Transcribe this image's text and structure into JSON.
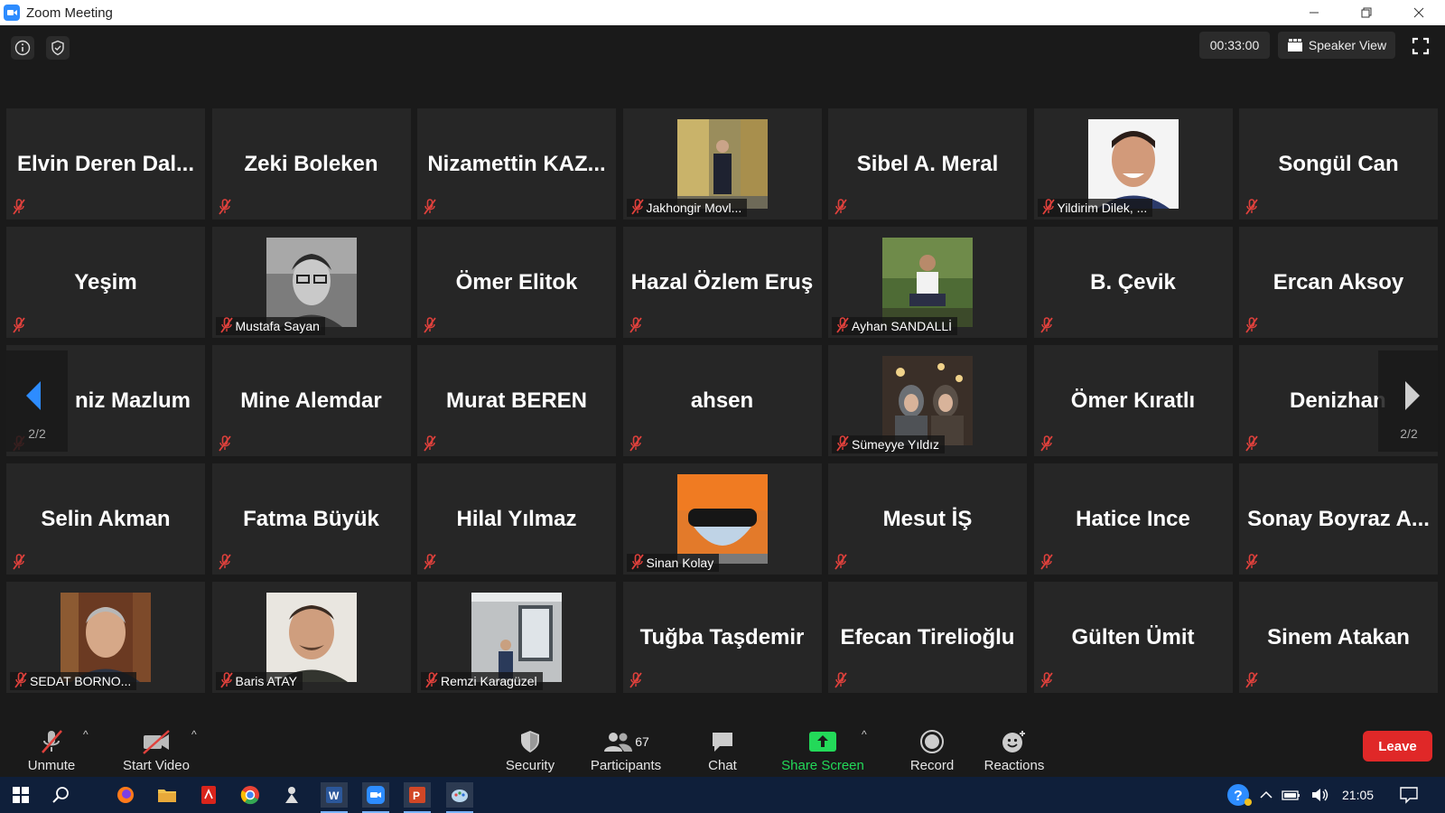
{
  "window": {
    "title": "Zoom Meeting"
  },
  "topbar": {
    "timer": "00:33:00",
    "view_button": "Speaker View"
  },
  "pagination": {
    "left_page": "2/2",
    "right_page": "2/2"
  },
  "tiles": [
    {
      "name": "Elvin  Deren  Dal...",
      "video": false
    },
    {
      "name": "Zeki Boleken",
      "video": false
    },
    {
      "name": "Nizamettin  KAZ...",
      "video": false
    },
    {
      "name": "Jakhongir Movl...",
      "video": true,
      "photo": "photo-1"
    },
    {
      "name": "Sibel A. Meral",
      "video": false
    },
    {
      "name": "Yildirim Dilek, ...",
      "video": true,
      "photo": "photo-2"
    },
    {
      "name": "Songül Can",
      "video": false
    },
    {
      "name": "Yeşim",
      "video": false
    },
    {
      "name": "Mustafa Sayan",
      "video": true,
      "photo": "photo-3"
    },
    {
      "name": "Ömer Elitok",
      "video": false
    },
    {
      "name": "Hazal Özlem Eruş",
      "video": false
    },
    {
      "name": "Ayhan SANDALLİ",
      "video": true,
      "photo": "photo-4"
    },
    {
      "name": "B. Çevik",
      "video": false
    },
    {
      "name": "Ercan Aksoy",
      "video": false
    },
    {
      "name": "niz Mazlum",
      "video": false
    },
    {
      "name": "Mine Alemdar",
      "video": false
    },
    {
      "name": "Murat BEREN",
      "video": false
    },
    {
      "name": "ahsen",
      "video": false
    },
    {
      "name": "Sümeyye Yıldız",
      "video": true,
      "photo": "photo-5"
    },
    {
      "name": "Ömer Kıratlı",
      "video": false
    },
    {
      "name": "Denizhan",
      "video": false
    },
    {
      "name": "Selin Akman",
      "video": false
    },
    {
      "name": "Fatma Büyük",
      "video": false
    },
    {
      "name": "Hilal Yılmaz",
      "video": false
    },
    {
      "name": "Sinan Kolay",
      "video": true,
      "photo": "photo-6"
    },
    {
      "name": "Mesut İŞ",
      "video": false
    },
    {
      "name": "Hatice Ince",
      "video": false
    },
    {
      "name": "Sonay  Boyraz  A...",
      "video": false
    },
    {
      "name": "SEDAT BORNO...",
      "video": true,
      "photo": "photo-7"
    },
    {
      "name": "Baris ATAY",
      "video": true,
      "photo": "photo-8"
    },
    {
      "name": "Remzi Karagüzel",
      "video": true,
      "photo": "photo-9"
    },
    {
      "name": "Tuğba Taşdemir",
      "video": false
    },
    {
      "name": "Efecan Tirelioğlu",
      "video": false
    },
    {
      "name": "Gülten Ümit",
      "video": false
    },
    {
      "name": "Sinem Atakan",
      "video": false
    }
  ],
  "toolbar": {
    "unmute": "Unmute",
    "start_video": "Start Video",
    "security": "Security",
    "participants": "Participants",
    "participants_count": "67",
    "chat": "Chat",
    "share_screen": "Share Screen",
    "record": "Record",
    "reactions": "Reactions",
    "leave": "Leave"
  },
  "colors": {
    "share_green": "#23d959",
    "leave_red": "#e02828",
    "muted_red": "#e0413c",
    "nav_blue": "#2d8cff"
  },
  "taskbar": {
    "time": "21:05"
  }
}
